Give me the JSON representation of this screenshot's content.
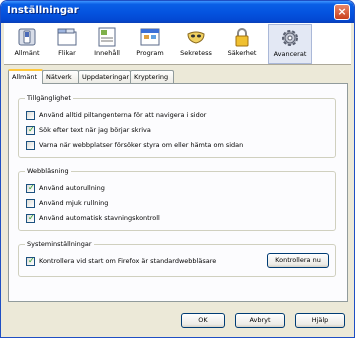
{
  "window": {
    "title": "Inställningar",
    "close_glyph": "×"
  },
  "toolbar": {
    "items": [
      {
        "label": "Allmänt",
        "icon": "switch-icon"
      },
      {
        "label": "Flikar",
        "icon": "tabs-icon"
      },
      {
        "label": "Innehåll",
        "icon": "content-icon"
      },
      {
        "label": "Program",
        "icon": "applications-icon"
      },
      {
        "label": "Sekretess",
        "icon": "mask-icon"
      },
      {
        "label": "Säkerhet",
        "icon": "lock-icon"
      },
      {
        "label": "Avancerat",
        "icon": "gear-icon",
        "active": true
      }
    ]
  },
  "tabs": [
    {
      "label": "Allmänt",
      "active": true
    },
    {
      "label": "Nätverk"
    },
    {
      "label": "Uppdateringar"
    },
    {
      "label": "Kryptering"
    }
  ],
  "accessibility": {
    "title": "Tillgänglighet",
    "options": [
      {
        "label": "Använd alltid piltangenterna för att navigera i sidor",
        "checked": false
      },
      {
        "label": "Sök efter text när jag börjar skriva",
        "checked": true
      },
      {
        "label": "Varna när webbplatser försöker styra om eller hämta om sidan",
        "checked": false
      }
    ]
  },
  "browsing": {
    "title": "Webbläsning",
    "options": [
      {
        "label": "Använd autorullning",
        "checked": true
      },
      {
        "label": "Använd mjuk rullning",
        "checked": false
      },
      {
        "label": "Använd automatisk stavningskontroll",
        "checked": true
      }
    ]
  },
  "system": {
    "title": "Systeminställningar",
    "default_check_label": "Kontrollera vid start om Firefox är standardwebbläsare",
    "default_check_checked": true,
    "check_now_label": "Kontrollera nu"
  },
  "footer": {
    "ok_label": "OK",
    "cancel_label": "Avbryt",
    "help_label": "Hjälp"
  },
  "colors": {
    "titlebar": "#0554e0",
    "check": "#21a121",
    "active_tab": "#ffc83c"
  }
}
